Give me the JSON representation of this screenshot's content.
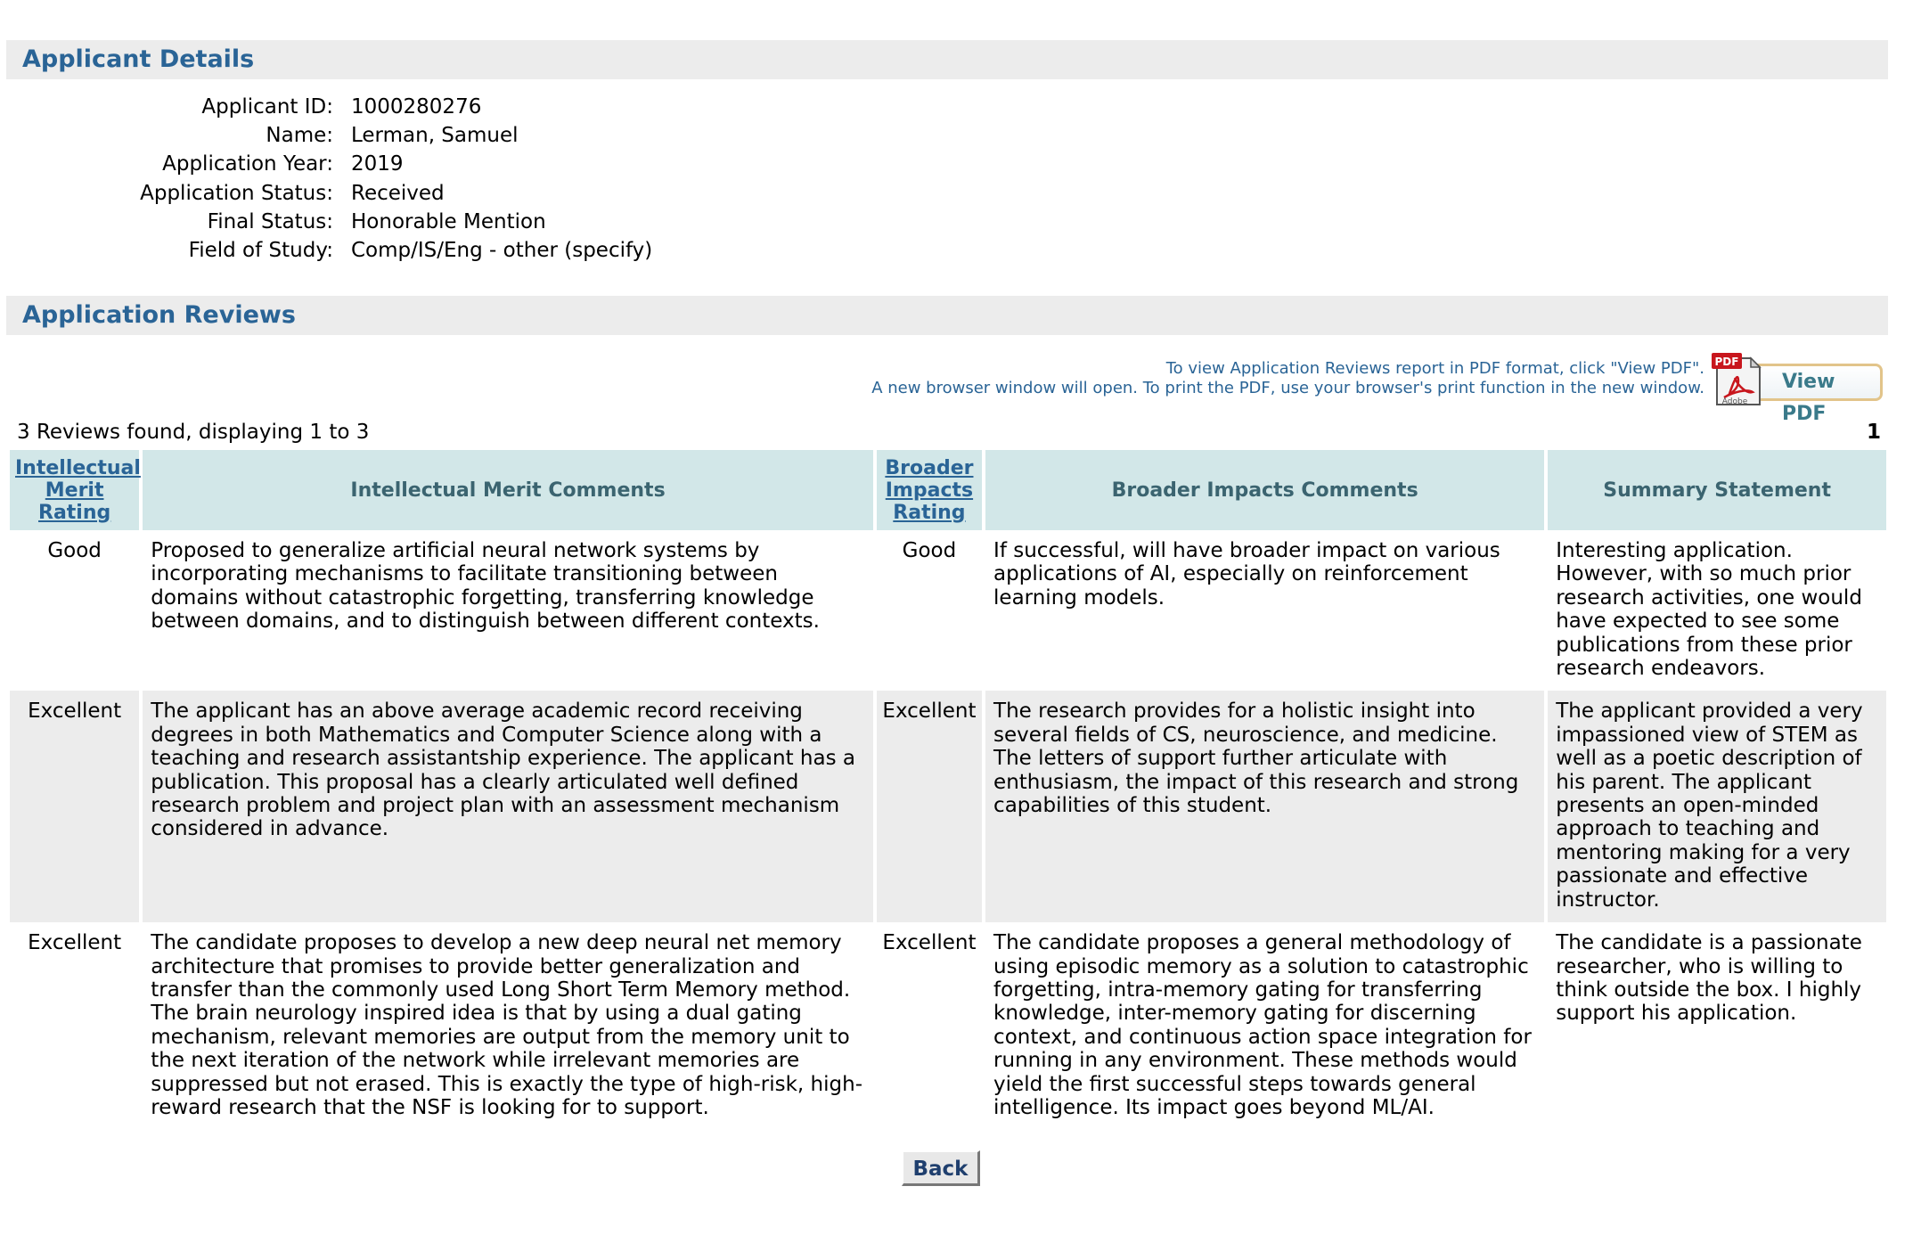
{
  "sections": {
    "details_title": "Applicant Details",
    "reviews_title": "Application Reviews"
  },
  "applicant": {
    "rows": [
      {
        "label": "Applicant ID:",
        "value": "1000280276"
      },
      {
        "label": "Name:",
        "value": "Lerman, Samuel"
      },
      {
        "label": "Application Year:",
        "value": "2019"
      },
      {
        "label": "Application Status:",
        "value": "Received"
      },
      {
        "label": "Final Status:",
        "value": "Honorable Mention"
      },
      {
        "label": "Field of Study:",
        "value": "Comp/IS/Eng - other (specify)"
      }
    ]
  },
  "pdf": {
    "note_line1": "To view Application Reviews report in PDF format, click \"View PDF\".",
    "note_line2": "A new browser window will open. To print the PDF, use your browser's print function in the new window.",
    "button_label": "View PDF",
    "icon_badge": "PDF",
    "icon_caption": "Adobe",
    "icon": "adobe-pdf-icon"
  },
  "results": {
    "count_text": "3 Reviews found, displaying 1 to 3",
    "page_number": "1"
  },
  "table": {
    "headers": {
      "im_rating": [
        "Intellectual",
        "Merit",
        "Rating"
      ],
      "im_comments": "Intellectual Merit Comments",
      "bi_rating": [
        "Broader",
        "Impacts",
        "Rating"
      ],
      "bi_comments": "Broader Impacts Comments",
      "summary": "Summary Statement"
    },
    "rows": [
      {
        "im_rating": "Good",
        "im_comments": "Proposed to generalize artificial neural network systems by incorporating mechanisms to facilitate transitioning between domains without catastrophic forgetting, transferring knowledge between domains, and to distinguish between different contexts.",
        "bi_rating": "Good",
        "bi_comments": "If successful, will have broader impact on various applications of AI, especially on reinforcement learning models.",
        "summary": "Interesting application. However, with so much prior research activities, one would have expected to see some publications from these prior research endeavors."
      },
      {
        "im_rating": "Excellent",
        "im_comments": "The applicant has an above average academic record receiving degrees in both Mathematics and Computer Science along with a teaching and research assistantship experience. The applicant has a publication. This proposal has a clearly articulated well defined research problem and project plan with an assessment mechanism considered in advance.",
        "bi_rating": "Excellent",
        "bi_comments": "The research provides for a holistic insight into several fields of CS, neuroscience, and medicine. The letters of support further articulate with enthusiasm, the impact of this research and strong capabilities of this student.",
        "summary": "The applicant provided a very impassioned view of STEM as well as a poetic description of his parent. The applicant presents an open-minded approach to teaching and mentoring making for a very passionate and effective instructor."
      },
      {
        "im_rating": "Excellent",
        "im_comments": "The candidate proposes to develop a new deep neural net memory architecture that promises to provide better generalization and transfer than the commonly used Long Short Term Memory method. The brain neurology inspired idea is that by using a dual gating mechanism, relevant memories are output from the memory unit to the next iteration of the network while irrelevant memories are suppressed but not erased. This is exactly the type of high-risk, high-reward research that the NSF is looking for to support.",
        "bi_rating": "Excellent",
        "bi_comments": "The candidate proposes a general methodology of using episodic memory as a solution to catastrophic forgetting, intra-memory gating for transferring knowledge, inter-memory gating for discerning context, and continuous action space integration for running in any environment. These methods would yield the first successful steps towards general intelligence. Its impact goes beyond ML/AI.",
        "summary": "The candidate is a passionate researcher, who is willing to think outside the box. I highly support his application."
      }
    ]
  },
  "back_button": {
    "label": "Back"
  },
  "colors": {
    "section_title": "#2a6496",
    "section_bar": "#ececec",
    "table_header": "#d2e7e8",
    "alt_row": "#ececec"
  }
}
